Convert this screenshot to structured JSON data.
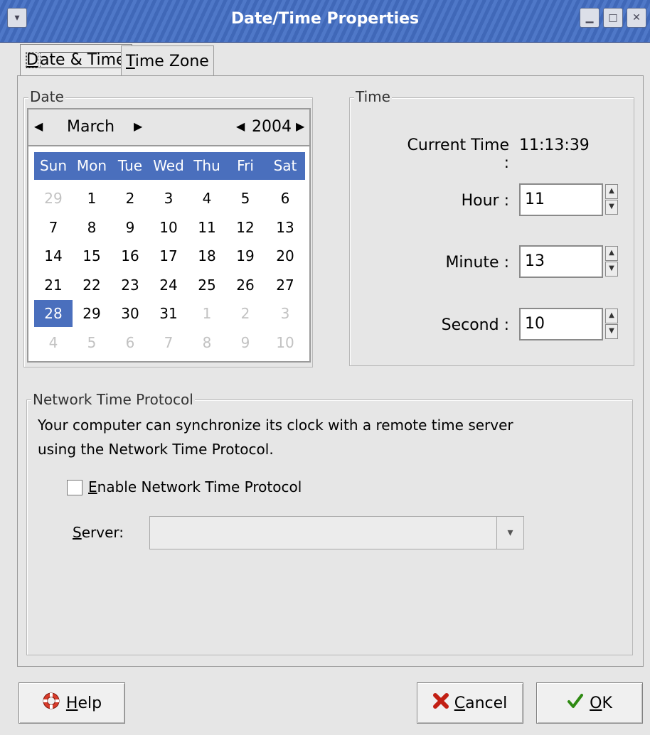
{
  "window": {
    "title": "Date/Time Properties"
  },
  "tabs": [
    {
      "label": "Date & Time",
      "mnemonic": "D",
      "rest": "ate & Time",
      "active": true
    },
    {
      "label": "Time Zone",
      "mnemonic": "T",
      "rest": "ime Zone",
      "active": false
    }
  ],
  "date_frame": {
    "label": "Date",
    "month": "March",
    "year": "2004",
    "weekdays": [
      "Sun",
      "Mon",
      "Tue",
      "Wed",
      "Thu",
      "Fri",
      "Sat"
    ],
    "weeks": [
      [
        "29",
        "1",
        "2",
        "3",
        "4",
        "5",
        "6"
      ],
      [
        "7",
        "8",
        "9",
        "10",
        "11",
        "12",
        "13"
      ],
      [
        "14",
        "15",
        "16",
        "17",
        "18",
        "19",
        "20"
      ],
      [
        "21",
        "22",
        "23",
        "24",
        "25",
        "26",
        "27"
      ],
      [
        "28",
        "29",
        "30",
        "31",
        "1",
        "2",
        "3"
      ],
      [
        "4",
        "5",
        "6",
        "7",
        "8",
        "9",
        "10"
      ]
    ],
    "selected_day": "28"
  },
  "time_frame": {
    "label": "Time",
    "current_time_label": "Current Time :",
    "current_time_value": "11:13:39",
    "hour_label": "Hour :",
    "hour_value": "11",
    "minute_label": "Minute :",
    "minute_value": "13",
    "second_label": "Second :",
    "second_value": "10"
  },
  "ntp": {
    "label": "Network Time Protocol",
    "desc_line1": "Your computer can synchronize its clock with a remote time server",
    "desc_line2": "using the Network Time Protocol.",
    "enable_label": "Enable Network Time Protocol",
    "enable_mnemonic": "E",
    "enable_rest": "nable Network Time Protocol",
    "enable_checked": false,
    "server_label": "Server:",
    "server_mnemonic": "S",
    "server_rest": "erver:",
    "server_value": ""
  },
  "buttons": {
    "help_label": "Help",
    "help_mnemonic": "H",
    "help_rest": "elp",
    "cancel_label": "Cancel",
    "cancel_mnemonic": "C",
    "cancel_rest": "ancel",
    "ok_label": "OK",
    "ok_mnemonic": "O",
    "ok_rest": "K"
  },
  "icons": {
    "window_menu": "chevron-down-icon",
    "minimize": "minimize-icon",
    "maximize": "maximize-icon",
    "close": "close-icon",
    "help": "lifebuoy-icon",
    "cancel": "cancel-x-icon",
    "ok": "checkmark-icon"
  },
  "colors": {
    "accent": "#4a6fbd",
    "titlebar": "#4f78c8"
  }
}
